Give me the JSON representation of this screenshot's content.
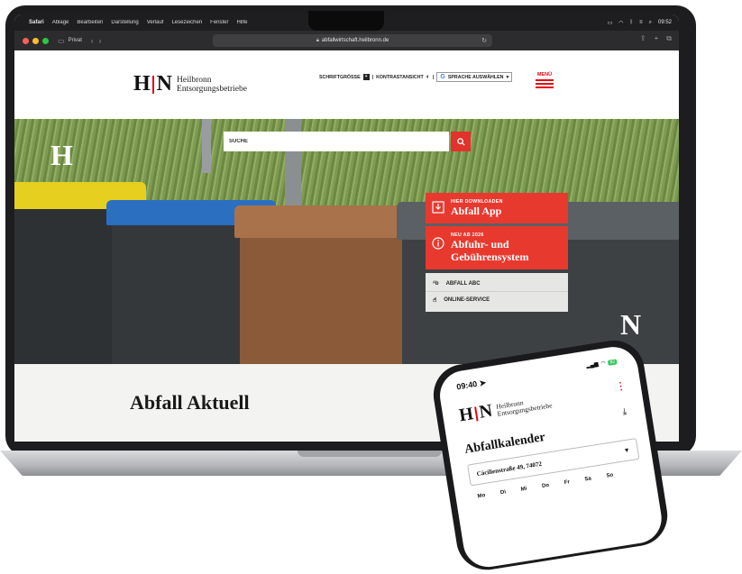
{
  "macos": {
    "apple": "",
    "app_name": "Safari",
    "menus": [
      "Ablage",
      "Bearbeiten",
      "Darstellung",
      "Verlauf",
      "Lesezeichen",
      "Fenster",
      "Hilfe"
    ],
    "clock": "09:52"
  },
  "browser": {
    "private_label": "Privat",
    "url": "abfallwirtschaft.heilbronn.de"
  },
  "site": {
    "logo_letters_left": "H",
    "logo_letters_right": "N",
    "logo_line1": "Heilbronn",
    "logo_line2": "Entsorgungsbetriebe",
    "font_size_label": "SCHRIFTGRÖSSE",
    "contrast_label": "KONTRASTANSICHT",
    "language_label": "SPRACHE AUSWÄHLEN",
    "menu_label": "MENÜ",
    "accent_color": "#e8392f"
  },
  "hero": {
    "search_placeholder": "SUCHE",
    "letter_left": "H",
    "letter_right": "N",
    "cta_app_kicker": "HIER DOWNLOADEN",
    "cta_app_title": "Abfall App",
    "cta_fee_kicker": "NEU AB 2026",
    "cta_fee_title_1": "Abfuhr- und",
    "cta_fee_title_2": "Gebührensystem",
    "link_abc": "ABFALL ABC",
    "link_online": "ONLINE-SERVICE"
  },
  "section": {
    "title": "Abfall Aktuell"
  },
  "phone": {
    "time": "09:40",
    "battery": "82",
    "logo_line1": "Heilbronn",
    "logo_line2": "Entsorgungsbetriebe",
    "title": "Abfallkalender",
    "address": "Cäcilienstraße 49, 74072",
    "weekdays": [
      "Mo",
      "Di",
      "Mi",
      "Do",
      "Fr",
      "Sa",
      "So"
    ]
  }
}
